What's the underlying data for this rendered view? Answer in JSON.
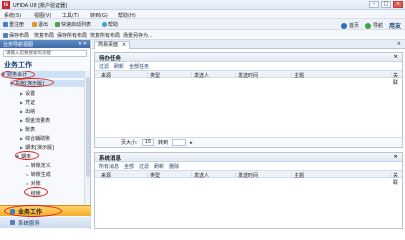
{
  "window": {
    "app_logo": "IS",
    "title": "UFIDA U8 [账户验证器]"
  },
  "menubar": [
    "系统(S)",
    "视图(V)",
    "工具(T)",
    "转到(G)",
    "帮助(H)"
  ],
  "toolbar1": [
    {
      "label": "重注册",
      "icon": "home-icon"
    },
    {
      "label": "退出",
      "icon": "exit-icon"
    },
    {
      "label": "快速启动列表",
      "icon": "list-icon"
    },
    {
      "label": "帮助",
      "icon": "help-icon"
    }
  ],
  "toolbar2": [
    "保存布局",
    "恢复布局",
    "保存所有布局",
    "恢复所有布局",
    "场景另存为..."
  ],
  "top_links": {
    "home": "首页",
    "navigate": "导航",
    "brand": "用友"
  },
  "left_panel": {
    "header": "业务导航视图",
    "search_placeholder": "请输入您要搜索的功能",
    "section": "业务工作",
    "tree": [
      "财务会计",
      "总账[演示版]",
      "设置",
      "凭证",
      "出纳",
      "现金流量表",
      "账表",
      "综合辅助账",
      "期末[演示版]",
      "期末",
      "转账定义",
      "转账生成",
      "对账",
      "结账"
    ]
  },
  "nav_buttons": {
    "business": "业务工作",
    "system": "系统服务"
  },
  "tab": {
    "label": "简易桌面"
  },
  "tasks_panel": {
    "title": "待办任务",
    "tools": [
      "过滤",
      "刷新",
      "全部任务"
    ],
    "columns": [
      "来源",
      "类型",
      "发送人",
      "发送时间",
      "主题",
      "关联"
    ],
    "pager": {
      "page_size_label": "页大小:",
      "page_size": "15",
      "go_to_label": "转到"
    }
  },
  "messages_panel": {
    "title": "系统消息",
    "tools": [
      "所有消息",
      "全部",
      "过滤",
      "刷新",
      "删除"
    ],
    "columns": [
      "来源",
      "类型",
      "发送人",
      "发送时间",
      "主题",
      "关联"
    ]
  }
}
